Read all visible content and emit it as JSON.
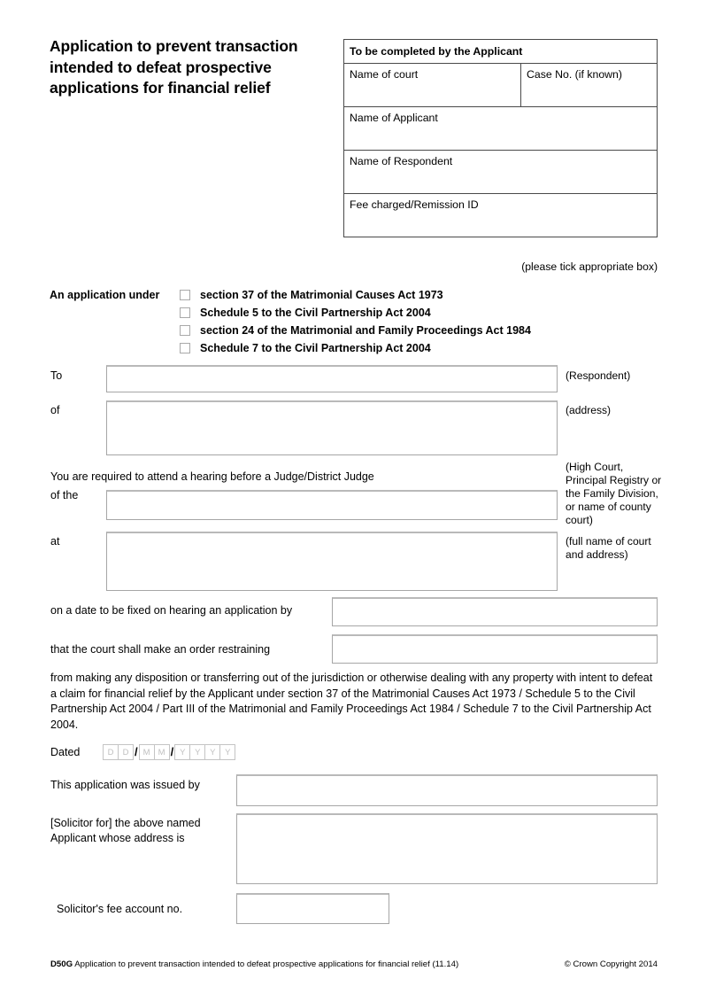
{
  "form": {
    "title": "Application to prevent transaction intended to defeat prospective applications for financial relief"
  },
  "applicant_table": {
    "header": "To be completed by the Applicant",
    "rows": [
      {
        "left": "Name of court",
        "right": "Case No. (if known)"
      },
      {
        "left": "Name of Applicant"
      },
      {
        "left": "Name of Respondent"
      },
      {
        "left": "Fee charged/Remission ID"
      }
    ]
  },
  "tick_note": "(please tick appropriate box)",
  "application_under": {
    "label": "An application under",
    "options": [
      "section 37 of the Matrimonial Causes Act 1973",
      "Schedule 5 to the Civil Partnership Act 2004",
      "section 24 of the Matrimonial and Family Proceedings Act 1984",
      "Schedule 7 to the Civil Partnership Act 2004"
    ]
  },
  "fields": {
    "to_label": "To",
    "to_value": "",
    "to_note": "(Respondent)",
    "of_label": "of",
    "of_value": "",
    "of_note": "(address)",
    "hearing_text": "You are required to attend a hearing before a Judge/District Judge",
    "of_the_label": "of the",
    "of_the_value": "",
    "of_the_note": "(High Court, Principal Registry or the Family Division, or name of county court)",
    "at_label": "at",
    "at_value": "",
    "at_note": "(full name of court and address)",
    "on_date_label": "on a date to be fixed on hearing an application by",
    "on_date_value": "",
    "order_label": "that the court shall make an order restraining",
    "order_value": "",
    "restraining_paragraph": "from making any disposition or transferring out of the jurisdiction or otherwise dealing with any property with intent to defeat a claim for financial relief by the Applicant under section 37 of the Matrimonial Causes Act 1973 / Schedule 5 to the Civil Partnership Act 2004 / Part III of the Matrimonial and Family Proceedings Act 1984 / Schedule 7 to the Civil Partnership Act 2004.",
    "dated_label": "Dated",
    "date_day": [
      "D",
      "D"
    ],
    "date_month": [
      "M",
      "M"
    ],
    "date_year": [
      "Y",
      "Y",
      "Y",
      "Y"
    ],
    "date_separator": "/",
    "issued_by_label": "This application was issued by",
    "issued_by_value": "",
    "solicitor_for_label": "[Solicitor for] the above named Applicant whose address is",
    "solicitor_for_value": "",
    "fee_account_label": "Solicitor's fee account no.",
    "fee_account_value": ""
  },
  "footer": {
    "code": "D50G",
    "description": "Application to prevent transaction intended to defeat prospective applications for financial relief (11.14)",
    "copyright": "© Crown Copyright 2014"
  }
}
